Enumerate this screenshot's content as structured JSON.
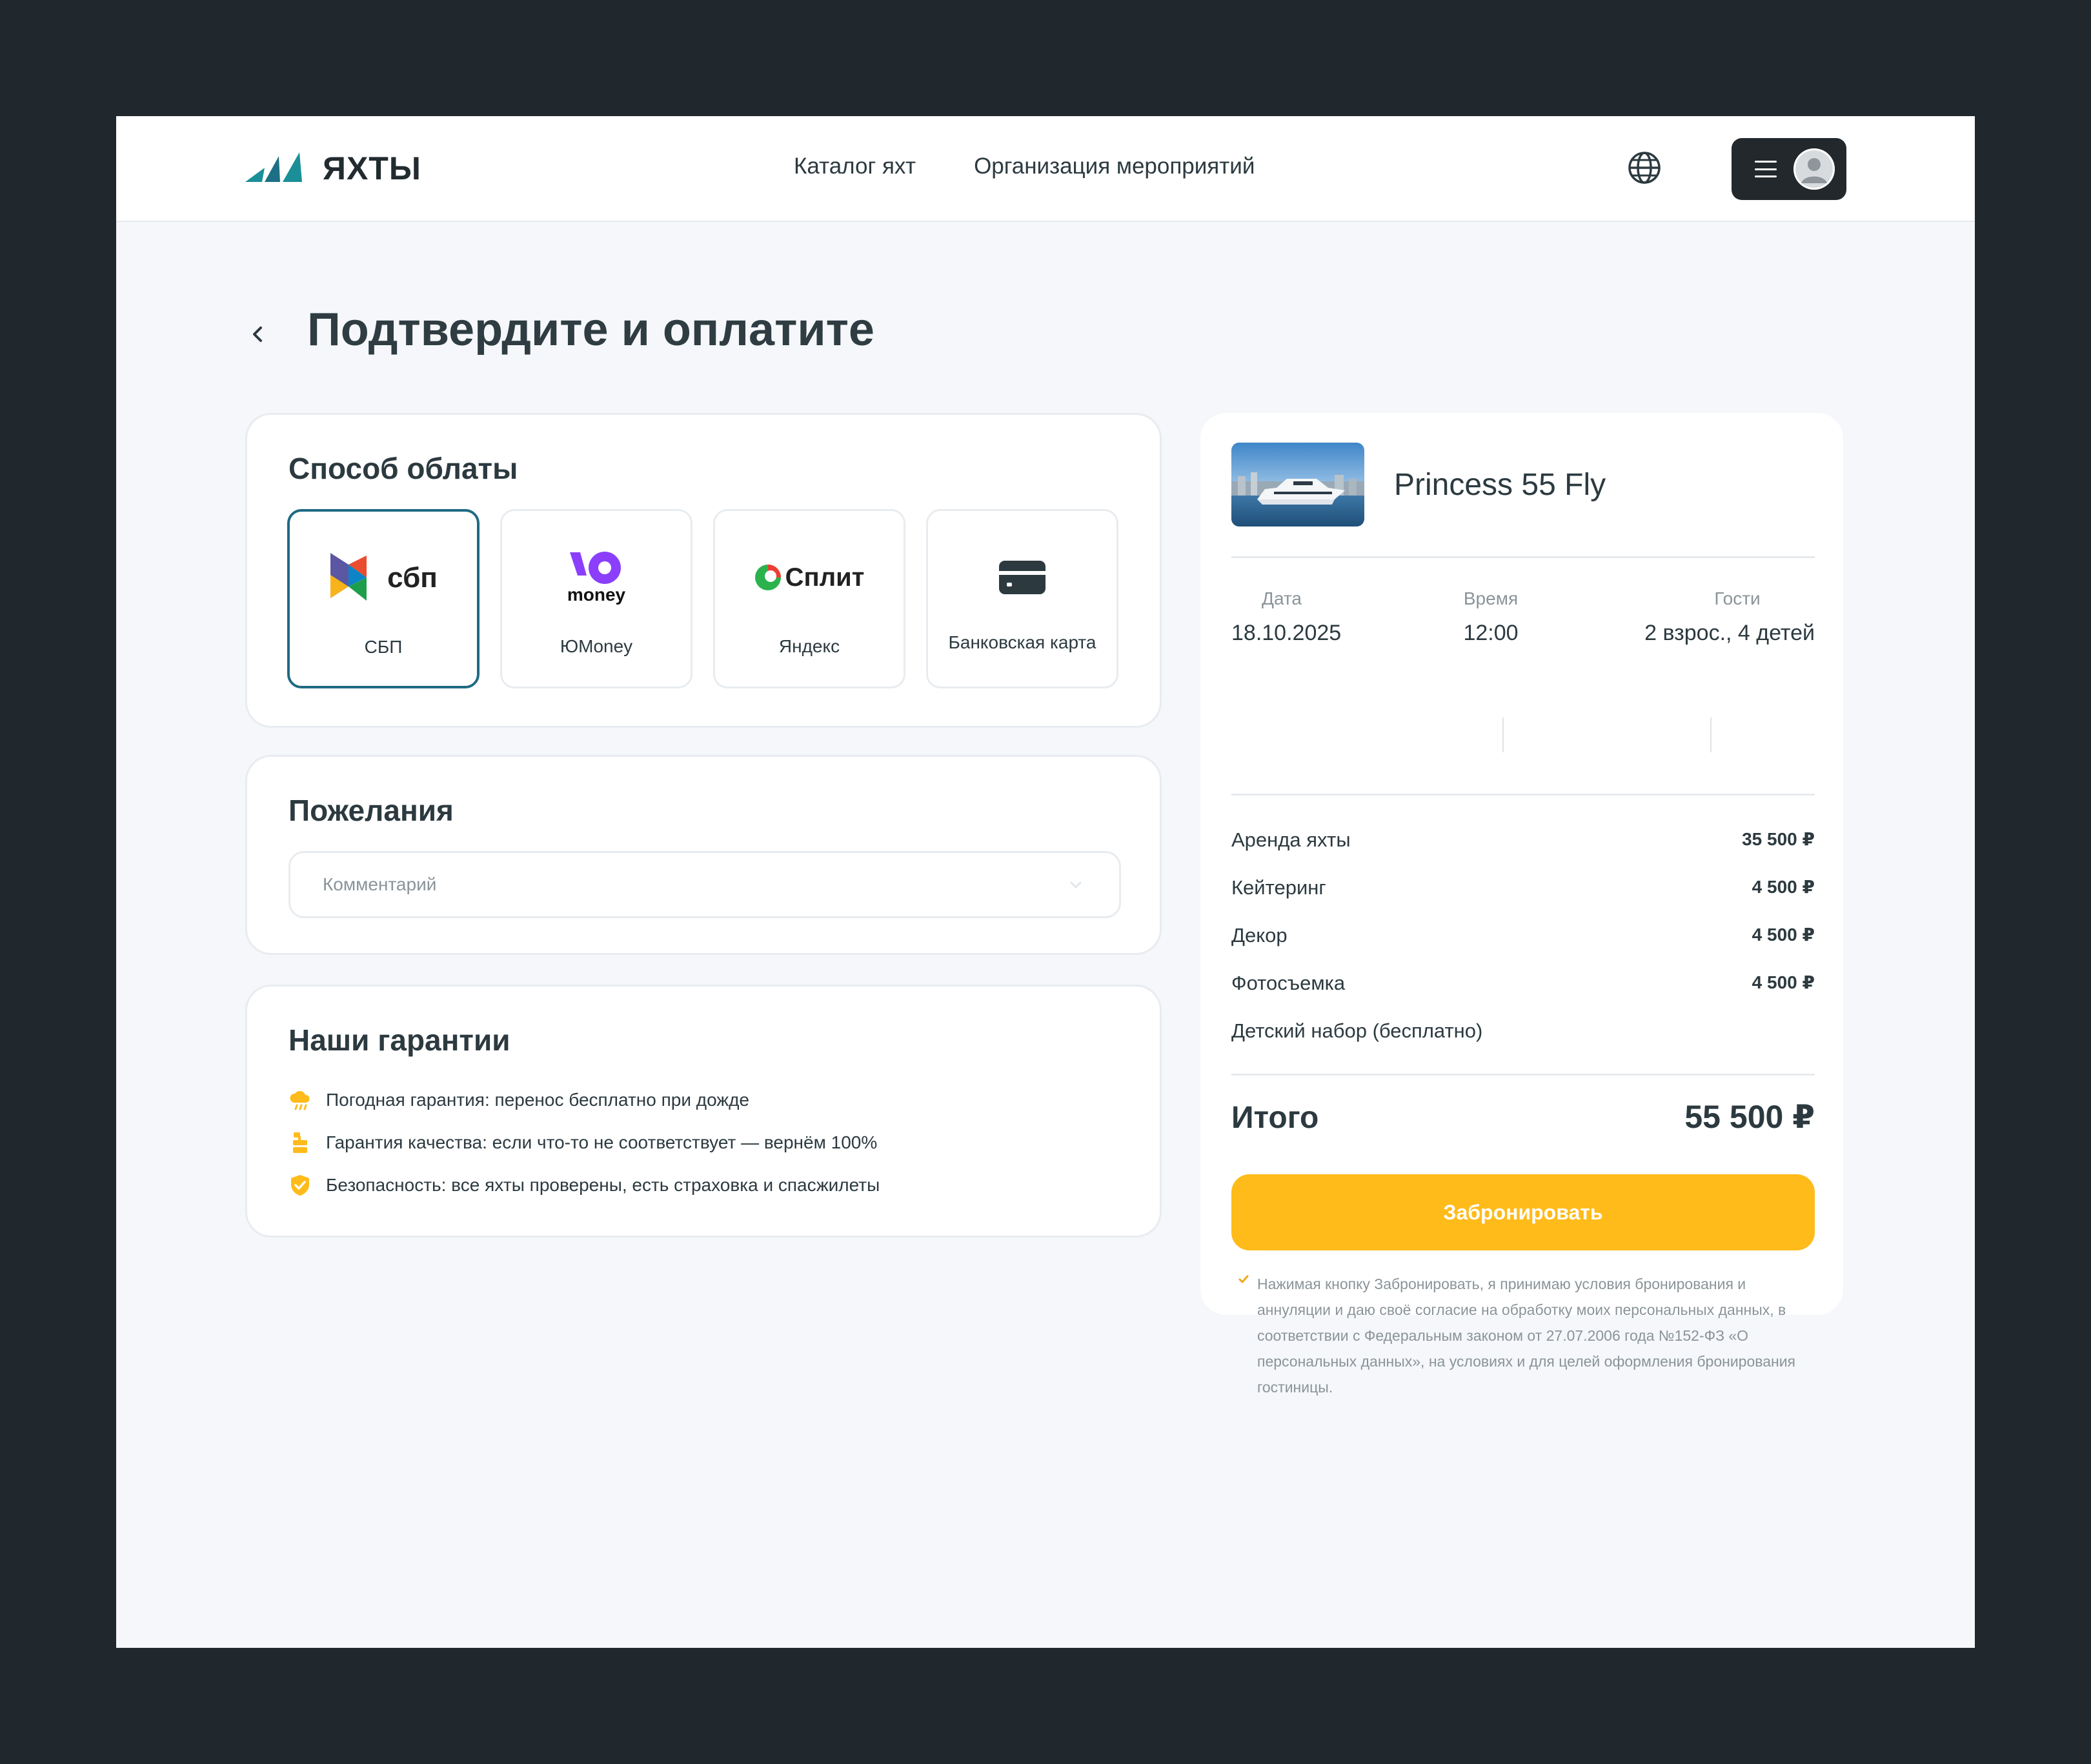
{
  "header": {
    "logo_text": "ЯХТЫ",
    "nav": [
      "Каталог яхт",
      "Организация мероприятий"
    ]
  },
  "page": {
    "title": "Подтвердите и оплатите"
  },
  "payment": {
    "title": "Способ облаты",
    "options": [
      {
        "logo": "сбп",
        "label": "СБП",
        "icon": "sbp-logo-icon",
        "selected": true
      },
      {
        "logo": "money",
        "label": "ЮMoney",
        "icon": "yoomoney-logo-icon",
        "selected": false
      },
      {
        "logo": "Сплит",
        "label": "Яндекс",
        "icon": "split-logo-icon",
        "selected": false
      },
      {
        "logo": "",
        "label": "Банковская карта",
        "icon": "bank-card-icon",
        "selected": false
      }
    ],
    "accent_color": "#1f6a83"
  },
  "wishes": {
    "title": "Пожелания",
    "comment_placeholder": "Комментарий",
    "comment_value": ""
  },
  "guarantees": {
    "title": "Наши гарантии",
    "items": [
      {
        "icon": "weather-cloud-icon",
        "text": "Погодная гарантия: перенос бесплатно при дожде"
      },
      {
        "icon": "quality-badge-icon",
        "text": "Гарантия качества: если что-то не соответствует — вернём 100%"
      },
      {
        "icon": "shield-check-icon",
        "text": "Безопасность: все яхты проверены, есть страховка и спасжилеты"
      }
    ],
    "icon_color": "#ffbb1a"
  },
  "order": {
    "yacht_name": "Princess 55 Fly",
    "date_label": "Дата",
    "date_value": "18.10.2025",
    "time_label": "Время",
    "time_value": "12:00",
    "guests_label": "Гости",
    "guests_value": "2 взрос., 4 детей",
    "lines": [
      {
        "name": "Аренда яхты",
        "amount": "35 500 ₽"
      },
      {
        "name": "Кейтеринг",
        "amount": "4 500 ₽"
      },
      {
        "name": "Декор",
        "amount": "4 500 ₽"
      },
      {
        "name": "Фотосъемка",
        "amount": "4 500 ₽"
      },
      {
        "name": "Детский набор  (бесплатно)",
        "amount": ""
      }
    ],
    "total_label": "Итого",
    "total_value": "55 500 ₽",
    "book_button": "Забронировать",
    "button_color": "#ffbb1a",
    "consent": "Нажимая кнопку Забронировать, я принимаю условия бронирования и аннуляции и даю своё согласие на обработку моих персональных данных, в соответствии с Федеральным законом от 27.07.2006 года №152-ФЗ «О персональных данных», на условиях и для целей оформления бронирования гостиницы."
  }
}
